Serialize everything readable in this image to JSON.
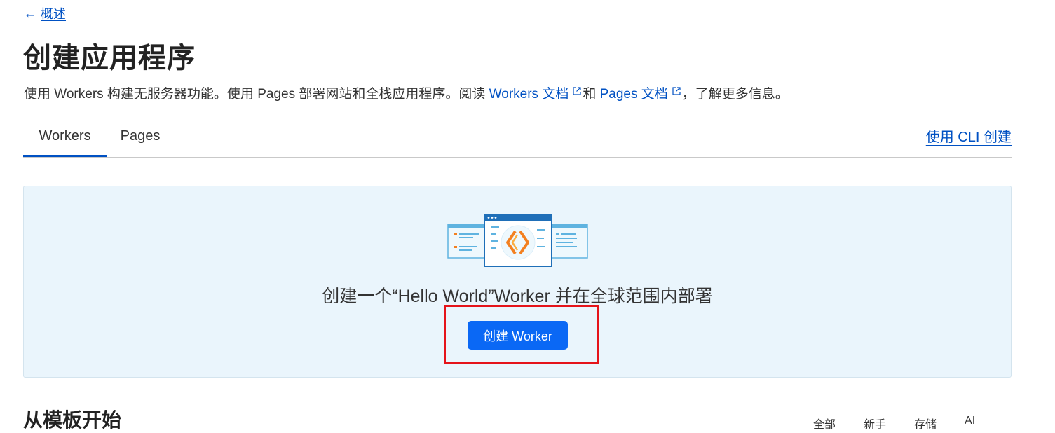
{
  "breadcrumb": {
    "label": "概述"
  },
  "page": {
    "title": "创建应用程序",
    "desc_part1": "使用 Workers 构建无服务器功能。使用 Pages 部署网站和全栈应用程序。阅读 ",
    "workers_docs": "Workers 文档",
    "desc_and": "和",
    "pages_docs": "Pages 文档",
    "desc_part2": "，了解更多信息。"
  },
  "tabs": [
    {
      "label": "Workers",
      "active": true
    },
    {
      "label": "Pages",
      "active": false
    }
  ],
  "cli_link": "使用 CLI 创建",
  "hello_panel": {
    "text": "创建一个“Hello World”Worker 并在全球范围内部署",
    "button_label": "创建 Worker"
  },
  "templates": {
    "title": "从模板开始",
    "filters": [
      "全部",
      "新手",
      "存储",
      "AI"
    ]
  },
  "colors": {
    "accent": "#0051c3",
    "button": "#0a68f5",
    "panel_bg": "#eaf5fc",
    "highlight": "#e5141a",
    "logo_orange": "#f38020"
  }
}
